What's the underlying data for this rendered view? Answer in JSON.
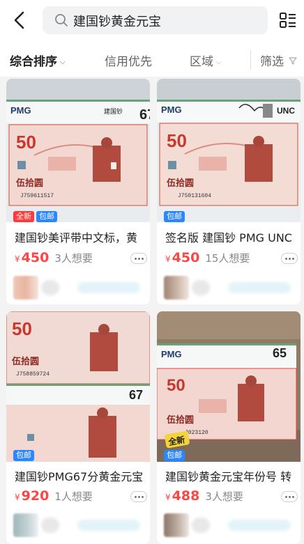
{
  "search": {
    "query": "建国钞黄金元宝"
  },
  "filters": [
    {
      "label": "综合排序",
      "active": true
    },
    {
      "label": "信用优先"
    },
    {
      "label": "区域"
    },
    {
      "label": "筛选"
    }
  ],
  "items": [
    {
      "tags": [
        "全新",
        "包邮"
      ],
      "title": "建国钞美评带中文标，黄",
      "price": "450",
      "currency": "¥",
      "wants": "3人想要",
      "photo": {
        "grade": "67",
        "brand": "PMG",
        "side_text": "建国钞",
        "note_value": "50",
        "denomination": "伍拾圆",
        "serial": "J759611517"
      }
    },
    {
      "tags": [
        "包邮"
      ],
      "title": "签名版 建国钞 PMG  UNC",
      "price": "450",
      "currency": "¥",
      "wants": "15人想要",
      "photo": {
        "grade": "UNC",
        "brand": "PMG",
        "side_text": "建国钞",
        "note_value": "50",
        "denomination": "伍拾圆",
        "serial": "J750131604"
      }
    },
    {
      "tags": [
        "包邮"
      ],
      "title": "建国钞PMG67分黄金元宝",
      "price": "920",
      "currency": "¥",
      "wants": "1人想要",
      "photo": {
        "grade": "67",
        "brand": "PMG",
        "note_value": "50",
        "denomination": "伍拾圆",
        "serial": "J758859724"
      }
    },
    {
      "tags": [
        "包邮"
      ],
      "title": "建国钞黄金元宝年份号 转",
      "price": "488",
      "currency": "¥",
      "wants": "3人想要",
      "photo": {
        "grade": "65",
        "brand": "PMG",
        "note_value": "50",
        "denomination": "伍拾圆",
        "serial": "J023120",
        "sticker": "全新"
      }
    }
  ],
  "colors": {
    "price": "#ff4444",
    "tag_new": "#ff3a3a",
    "tag_mail": "#2b86ff",
    "note_red": "#d9463f"
  }
}
